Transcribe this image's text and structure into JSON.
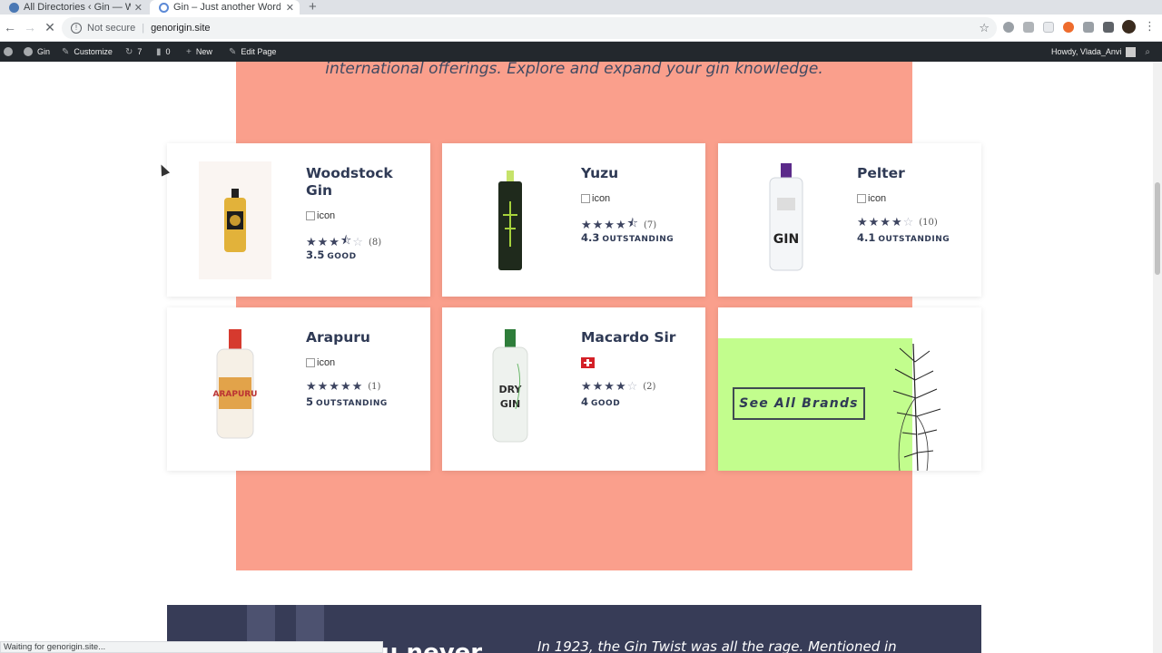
{
  "browser": {
    "tabs": [
      {
        "title": "All Directories ‹ Gin — Wo",
        "close": "✕"
      },
      {
        "title": "Gin – Just another WordP",
        "close": "✕"
      }
    ],
    "new_tab": "+",
    "nav": {
      "back": "←",
      "forward": "→",
      "reload": "✕"
    },
    "security_label": "Not secure",
    "url": "genorigin.site",
    "bookmark_icon": "☆",
    "menu_icon": "⋮"
  },
  "admin_bar": {
    "site": "Gin",
    "customize": "Customize",
    "updates": "7",
    "comments": "0",
    "new": "New",
    "edit": "Edit Page",
    "howdy": "Howdy, Vlada_Anvi"
  },
  "intro_text": "international offerings. Explore and expand your gin knowledge.",
  "brands": [
    {
      "name": "Woodstock Gin",
      "flag": "icon",
      "stars": 3.5,
      "star_chars": "★★★",
      "half": "⯪",
      "empty": "☆",
      "count": "(8)",
      "score": "3.5",
      "word": "GOOD",
      "bottle_color": "#e2b23a"
    },
    {
      "name": "Yuzu",
      "flag": "icon",
      "stars": 4.5,
      "star_chars": "★★★★",
      "half": "⯪",
      "empty": "",
      "count": "(7)",
      "score": "4.3",
      "word": "OUTSTANDING",
      "bottle_color": "#1f2a1c"
    },
    {
      "name": "Pelter",
      "flag": "icon",
      "stars": 4,
      "star_chars": "★★★★",
      "half": "",
      "empty": "☆",
      "count": "(10)",
      "score": "4.1",
      "word": "OUTSTANDING",
      "bottle_color": "#f0f2f4"
    },
    {
      "name": "Arapuru",
      "flag": "icon",
      "stars": 5,
      "star_chars": "★★★★★",
      "half": "",
      "empty": "",
      "count": "(1)",
      "score": "5",
      "word": "OUTSTANDING",
      "bottle_color": "#f2e0c0"
    },
    {
      "name": "Macardo Sir",
      "flag": "swiss-flag",
      "stars": 4,
      "star_chars": "★★★★",
      "half": "",
      "empty": "☆",
      "count": "(2)",
      "score": "4",
      "word": "GOOD",
      "bottle_color": "#eef2ee"
    }
  ],
  "see_all_label": "See All Brands",
  "bottom_section": {
    "heading": "u never",
    "quote": "In 1923, the Gin Twist was all the rage. Mentioned in"
  },
  "status_text": "Waiting for genorigin.site...",
  "colors": {
    "salmon": "#fa9f8c",
    "navy": "#373c57",
    "green": "#c2fd8d",
    "text": "#2f3a55"
  }
}
